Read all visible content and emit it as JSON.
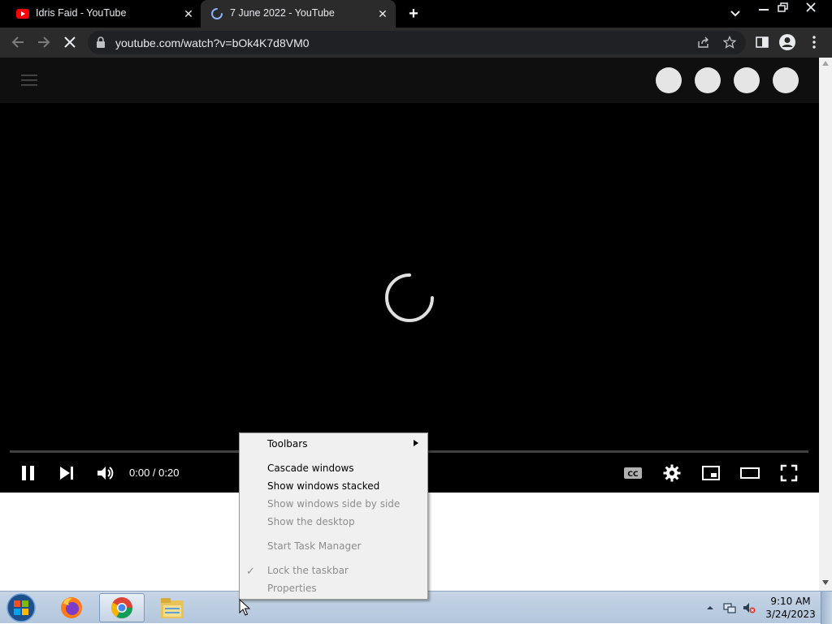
{
  "browser": {
    "tabs": [
      {
        "title": "Idris Faid - YouTube",
        "active": false
      },
      {
        "title": "7 June 2022 - YouTube",
        "active": true,
        "loading": true
      }
    ],
    "url": "youtube.com/watch?v=bOk4K7d8VM0"
  },
  "player": {
    "state": "loading",
    "time_display": "0:00 / 0:20",
    "progress": 0
  },
  "context_menu": {
    "items": [
      {
        "label": "Toolbars",
        "enabled": true,
        "has_submenu": true
      },
      {
        "label": "Cascade windows",
        "enabled": true
      },
      {
        "label": "Show windows stacked",
        "enabled": true
      },
      {
        "label": "Show windows side by side",
        "enabled": false
      },
      {
        "label": "Show the desktop",
        "enabled": false
      },
      {
        "label": "Start Task Manager",
        "enabled": false
      },
      {
        "label": "Lock the taskbar",
        "enabled": false,
        "checked": true
      },
      {
        "label": "Properties",
        "enabled": false
      }
    ]
  },
  "taskbar": {
    "apps": [
      "firefox-icon",
      "chrome-icon",
      "file-explorer-icon"
    ],
    "active_app": "chrome-icon",
    "time": "9:10 AM",
    "date": "3/24/2023"
  },
  "colors": {
    "tabstrip": "#000000",
    "toolbar": "#2b2b2b",
    "player_bg": "#000000",
    "youtube_red": "#ff0000",
    "loading_blue": "#8ab4f8"
  }
}
